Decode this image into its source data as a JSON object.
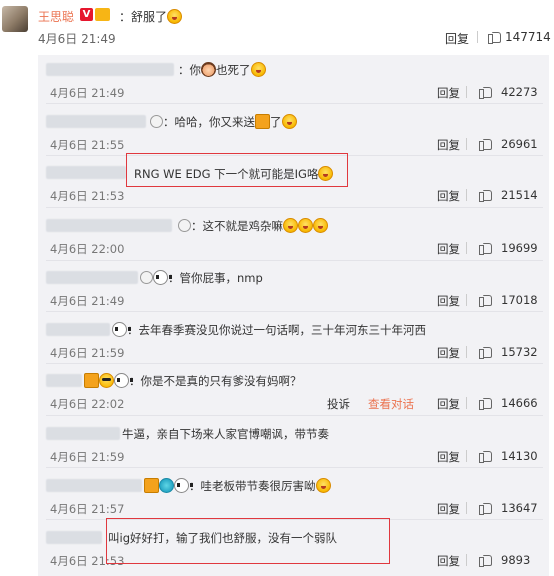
{
  "post": {
    "author": "王思聪",
    "text": "：舒服了",
    "date": "4月6日 21:49",
    "reply_label": "回复",
    "likes": "147714"
  },
  "comments": [
    {
      "text": "：你",
      "text2": "也死了",
      "date": "4月6日 21:49",
      "likes": "42273"
    },
    {
      "text": "：哈哈，你又来送",
      "text2": "了",
      "date": "4月6日 21:55",
      "likes": "26961"
    },
    {
      "text": "RNG WE EDG 下一个就可能是IG咯",
      "date": "4月6日 21:53",
      "likes": "21514"
    },
    {
      "text": "：这不就是鸡杂嘛",
      "date": "4月6日 22:00",
      "likes": "19699"
    },
    {
      "text": "：管你屁事，nmp",
      "date": "4月6日 21:49",
      "likes": "17018"
    },
    {
      "text": "：去年春季赛没见你说过一句话啊，三十年河东三十年河西",
      "date": "4月6日 21:59",
      "likes": "15732"
    },
    {
      "text": "：你是不是真的只有爹没有妈啊？",
      "date": "4月6日 22:02",
      "likes": "14666",
      "report": "投诉",
      "view": "查看对话"
    },
    {
      "text": "牛逼，亲自下场来人家官博嘲讽，带节奏",
      "date": "4月6日 21:59",
      "likes": "14130"
    },
    {
      "text": "：哇老板带节奏很厉害呦",
      "date": "4月6日 21:57",
      "likes": "13647"
    },
    {
      "text": "叫ig好好打，输了我们也舒服，没有一个弱队",
      "date": "4月6日 21:53",
      "likes": "9893"
    }
  ],
  "reply_label": "回复",
  "icons": [
    "v-badge-icon",
    "crown-icon",
    "grin-emoji-icon",
    "girl-emoji-icon",
    "panda-icon",
    "like-thumb-icon",
    "member-badge-icon"
  ],
  "colors": {
    "accent": "#eb7350",
    "highlight": "#e0383e",
    "panel": "#f2f2f5"
  }
}
